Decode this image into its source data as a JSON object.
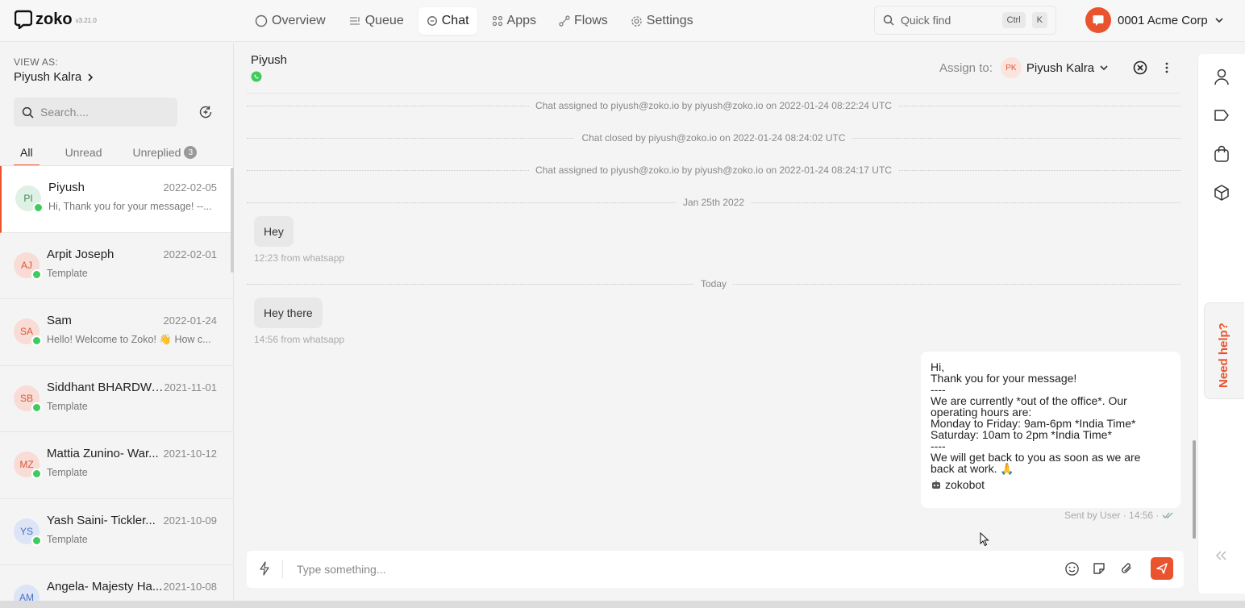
{
  "app": {
    "name": "zoko",
    "version": "v3.21.0"
  },
  "nav": {
    "items": [
      {
        "label": "Overview",
        "icon": "circle-icon"
      },
      {
        "label": "Queue",
        "icon": "queue-icon"
      },
      {
        "label": "Chat",
        "icon": "chat-icon",
        "active": true
      },
      {
        "label": "Apps",
        "icon": "apps-grid-icon"
      },
      {
        "label": "Flows",
        "icon": "flows-icon"
      },
      {
        "label": "Settings",
        "icon": "gear-icon"
      }
    ]
  },
  "quick_find": {
    "placeholder": "Quick find",
    "key1": "Ctrl",
    "key2": "K"
  },
  "org": {
    "name": "0001 Acme Corp"
  },
  "sidebar": {
    "view_as_label": "VIEW AS:",
    "view_as_user": "Piyush Kalra",
    "search_placeholder": "Search....",
    "tabs": [
      {
        "label": "All",
        "active": true
      },
      {
        "label": "Unread"
      },
      {
        "label": "Unreplied",
        "badge": "3"
      }
    ],
    "chats": [
      {
        "initials": "PI",
        "name": "Piyush",
        "date": "2022-02-05",
        "preview": "Hi, Thank you for your message! --...",
        "avatar_bg": "#dff0e4",
        "avatar_fg": "#3d8a52",
        "active": true
      },
      {
        "initials": "AJ",
        "name": "Arpit Joseph",
        "date": "2022-02-01",
        "preview": "Template",
        "avatar_bg": "#f8dcd5",
        "avatar_fg": "#d9583a"
      },
      {
        "initials": "SA",
        "name": "Sam",
        "date": "2022-01-24",
        "preview": "Hello! Welcome to Zoko! 👋 How c...",
        "avatar_bg": "#f8dcd5",
        "avatar_fg": "#d9583a"
      },
      {
        "initials": "SB",
        "name": "Siddhant BHARDWA...",
        "date": "2021-11-01",
        "preview": "Template",
        "avatar_bg": "#f8dcd5",
        "avatar_fg": "#d9583a"
      },
      {
        "initials": "MZ",
        "name": "Mattia Zunino- War...",
        "date": "2021-10-12",
        "preview": "Template",
        "avatar_bg": "#f8dcd5",
        "avatar_fg": "#d9583a"
      },
      {
        "initials": "YS",
        "name": "Yash Saini- Tickler...",
        "date": "2021-10-09",
        "preview": "Template",
        "avatar_bg": "#dce4f6",
        "avatar_fg": "#4a6fc7"
      },
      {
        "initials": "AM",
        "name": "Angela- Majesty Ha...",
        "date": "2021-10-08",
        "preview": "",
        "avatar_bg": "#dce4f6",
        "avatar_fg": "#4a6fc7"
      }
    ]
  },
  "conversation": {
    "contact_name": "Piyush",
    "assign_label": "Assign to:",
    "assignee_initials": "PK",
    "assignee_name": "Piyush Kalra",
    "system_messages": [
      "Chat assigned to piyush@zoko.io by piyush@zoko.io on 2022-01-24 08:22:24 UTC",
      "Chat closed by piyush@zoko.io on 2022-01-24 08:24:02 UTC",
      "Chat assigned to piyush@zoko.io by piyush@zoko.io on 2022-01-24 08:24:17 UTC"
    ],
    "date_separators": [
      "Jan 25th 2022",
      "Today"
    ],
    "incoming": [
      {
        "text": "Hey",
        "meta": "12:23 from whatsapp"
      },
      {
        "text": "Hey there",
        "meta": "14:56 from whatsapp"
      }
    ],
    "outgoing": {
      "lines": [
        "Hi,",
        "Thank you for your message!",
        "----",
        "We are currently *out of the office*. Our",
        "operating hours are:",
        "Monday to Friday: 9am-6pm *India Time*",
        "Saturday: 10am to 2pm *India Time*",
        "----",
        "We will get back to you as soon as we are",
        "back at work. 🙏"
      ],
      "signature": "zokobot",
      "meta": "Sent by User · 14:56 ·"
    },
    "composer_placeholder": "Type something..."
  },
  "help_tab": "Need help?",
  "colors": {
    "accent": "#e9542f",
    "whatsapp": "#3fcb5d"
  }
}
